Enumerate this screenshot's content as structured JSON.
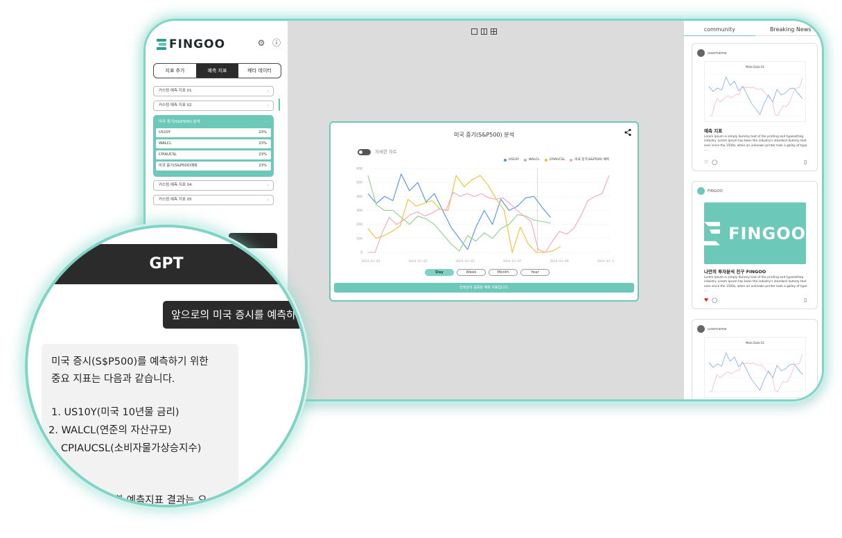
{
  "sidebar": {
    "logo_text": "FINGOO",
    "tabs": [
      "지표 추가",
      "예측 지표",
      "메타 데이터"
    ],
    "active_tab_index": 1,
    "items_top": [
      "커스텀 예측 지표 01",
      "커스텀 예측 지표 02"
    ],
    "group": {
      "title": "미국 증기(S&P500) 분석",
      "items": [
        {
          "label": "US10Y",
          "pct": "23%"
        },
        {
          "label": "WALCL",
          "pct": "23%"
        },
        {
          "label": "CPIAUCSL",
          "pct": "23%"
        },
        {
          "label": "미국 증기(S&P500)예측",
          "pct": "23%"
        }
      ]
    },
    "items_bottom": [
      "커스텀 예측 지표 04",
      "커스텀 예측 지표 05"
    ]
  },
  "chart_panel": {
    "title": "미국 증기(S&P500) 분석",
    "toggle_label": "자세한 차트",
    "period_buttons": [
      "Day",
      "Week",
      "Month",
      "Year"
    ],
    "active_period_index": 0,
    "footer_text": "안정성이 검증된 예측 지표입니다."
  },
  "chart_data": {
    "type": "line",
    "ylim": [
      0,
      600
    ],
    "yticks": [
      "0",
      "100",
      "200",
      "300",
      "400",
      "500",
      "600"
    ],
    "xticks": [
      "2024-01-01",
      "2024-01-03",
      "2024-01-05",
      "2024-01-07",
      "2024-01-09",
      "2024-01-11"
    ],
    "divider_x": 0.7,
    "series": [
      {
        "name": "US10Y",
        "color": "#4e8fe6",
        "values": [
          420,
          350,
          400,
          370,
          560,
          440,
          500,
          360,
          420,
          300,
          180,
          100,
          20,
          180,
          300,
          200,
          380,
          300,
          330,
          390,
          400,
          320,
          250
        ]
      },
      {
        "name": "WALCL",
        "color": "#8fcf8c",
        "values": [
          550,
          340,
          300,
          300,
          250,
          200,
          260,
          240,
          200,
          130,
          60,
          10,
          120,
          80,
          140,
          100,
          170,
          200,
          270,
          260,
          230,
          220,
          210
        ]
      },
      {
        "name": "CPIAUCSL",
        "color": "#f2bf2a",
        "values": [
          170,
          100,
          120,
          150,
          190,
          380,
          330,
          350,
          370,
          310,
          300,
          550,
          470,
          520,
          550,
          480,
          380,
          300,
          0,
          180,
          60,
          0,
          0,
          10,
          40
        ]
      },
      {
        "name": "미국 증기(S&P500) 예측",
        "color": "#f5a3bd",
        "values": [
          0,
          0,
          140,
          250,
          200,
          230,
          270,
          290,
          260,
          280,
          310,
          300,
          430,
          400,
          420,
          400,
          420,
          390,
          380,
          390,
          350,
          300,
          260,
          220,
          20,
          0,
          80,
          150,
          130,
          170,
          260,
          370,
          400,
          420,
          550
        ]
      }
    ]
  },
  "right_panel": {
    "tabs": [
      "community",
      "Breaking News"
    ],
    "posts": [
      {
        "author": "username",
        "chart_title": "Meta Data 01",
        "title": "예측 지표",
        "body": "Lorem Ipsum is simply dummy text of the printing and typesetting industry. Lorem Ipsum has been the industry's standard dummy text ever since the 1500s, when an unknown printer took a galley of type ....",
        "liked": false
      },
      {
        "author": "FINGOO",
        "banner_text": "FINGOO",
        "title": "나만의 투자분석 친구 FINGOO",
        "body": "Lorem Ipsum is simply dummy text of the printing and typesetting industry. Lorem Ipsum has been the industry's standard dummy text ever since the 1500s, when an unknown printer took a galley of type ....",
        "liked": true
      },
      {
        "author": "username",
        "chart_title": "Meta Data 01"
      }
    ]
  },
  "gpt": {
    "title": "GPT",
    "user_message": "앞으로의 미국 증시를 예측하",
    "reply_line1": "미국 증시(S$P500)를 예측하기 위한",
    "reply_line2": "중요 지표는 다음과 같습니다.",
    "list": [
      "1. US10Y(미국 10년물 금리)",
      "2. WALCL(연준의 자산규모)",
      "CPIAUCSL(소비자물가상승지수)"
    ],
    "reply_tail": "반영한 예측지표 결과는 오"
  },
  "colors": {
    "accent": "#6cc8b8",
    "dark": "#2b2b2b"
  }
}
